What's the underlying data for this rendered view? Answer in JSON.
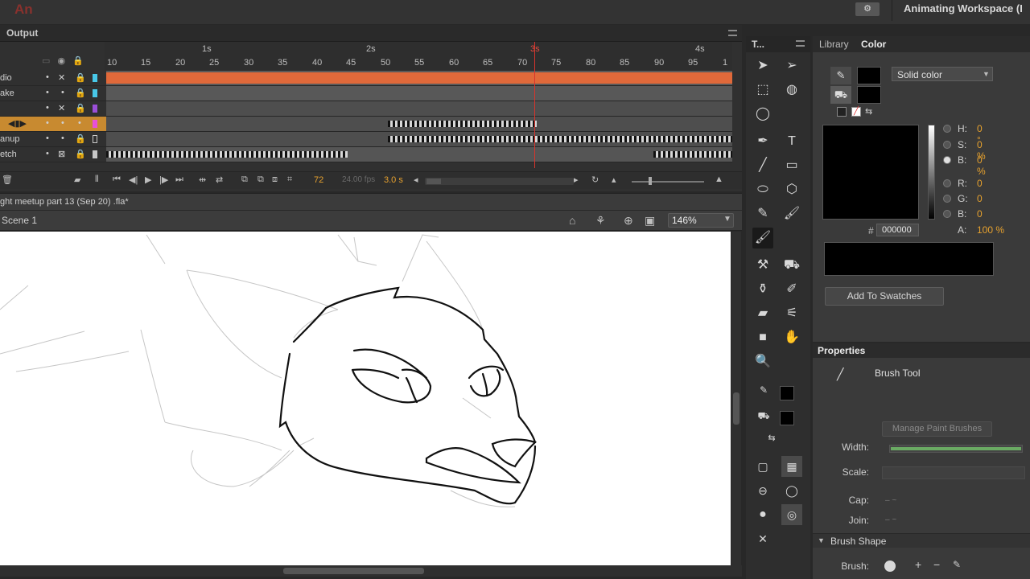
{
  "app": {
    "logo": "An",
    "workspace_title": "Animating Workspace (I",
    "workspace_switch_icon": "gear-icon"
  },
  "timeline": {
    "tab_label": "Output",
    "seconds": [
      "1s",
      "2s",
      "3s",
      "4s"
    ],
    "frames": [
      "10",
      "15",
      "20",
      "25",
      "30",
      "35",
      "40",
      "45",
      "50",
      "55",
      "60",
      "65",
      "70",
      "75",
      "80",
      "85",
      "90",
      "95",
      "1"
    ],
    "layers": [
      {
        "name": "dio",
        "color": "#48c8e8"
      },
      {
        "name": "ake",
        "color": "#48c8e8"
      },
      {
        "name": "",
        "color": "#9b4fd8"
      },
      {
        "name": "",
        "color": "#e850d8"
      },
      {
        "name": "anup",
        "color": "#c8c8c8"
      },
      {
        "name": "etch",
        "color": "#c8c8c8"
      }
    ],
    "current_frame": "72",
    "fps": "24.00 fps",
    "time": "3.0 s"
  },
  "document": {
    "name": "ght meetup part 13 (Sep 20) .fla*",
    "scene": "Scene 1",
    "zoom": "146%"
  },
  "tools": {
    "tab_label": "T..."
  },
  "color_panel": {
    "tab_library": "Library",
    "tab_color": "Color",
    "fill_type": "Solid color",
    "hsb": [
      {
        "label": "H:",
        "value": "0 °"
      },
      {
        "label": "S:",
        "value": "0 %"
      },
      {
        "label": "B:",
        "value": "0 %"
      }
    ],
    "rgb": [
      {
        "label": "R:",
        "value": "0"
      },
      {
        "label": "G:",
        "value": "0"
      },
      {
        "label": "B:",
        "value": "0"
      }
    ],
    "hash": "#",
    "hex": "000000",
    "alpha_label": "A:",
    "alpha": "100 %",
    "add_swatch": "Add To Swatches",
    "stroke_color": "#000000",
    "fill_color": "#000000"
  },
  "properties": {
    "tab_label": "Properties",
    "tool_name": "Brush Tool",
    "manage_brushes": "Manage Paint Brushes",
    "width_label": "Width:",
    "scale_label": "Scale:",
    "cap_label": "Cap:",
    "join_label": "Join:",
    "brush_shape": "Brush Shape",
    "brush_label": "Brush:"
  }
}
